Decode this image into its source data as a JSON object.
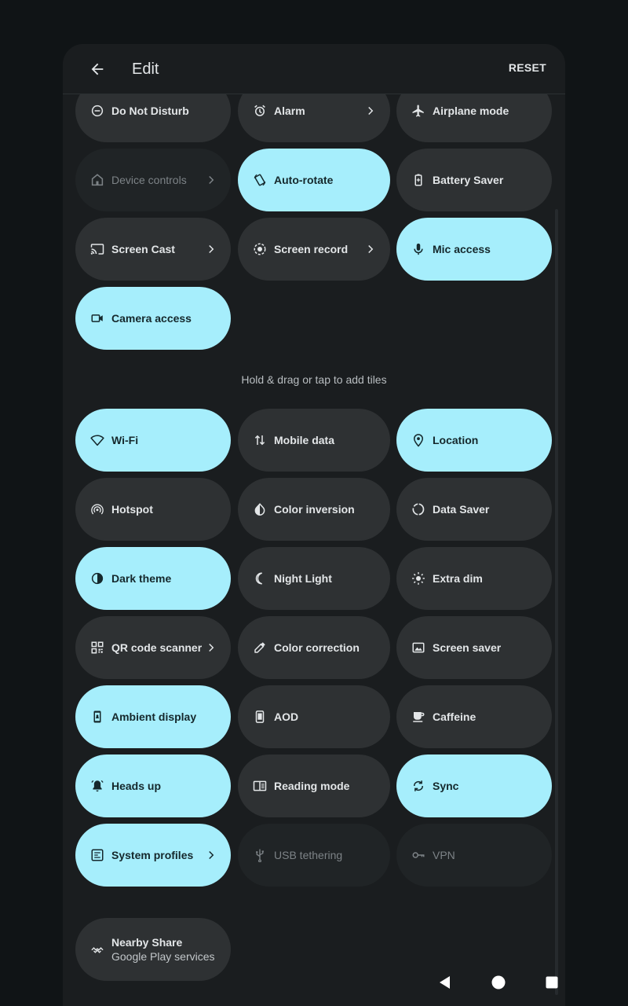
{
  "header": {
    "title": "Edit",
    "reset_label": "RESET"
  },
  "hint": "Hold & drag or tap to add tiles",
  "active_tiles": [
    {
      "label": "Do Not Disturb",
      "icon": "do-not-disturb-icon",
      "state": "off",
      "chevron": false
    },
    {
      "label": "Alarm",
      "icon": "alarm-icon",
      "state": "off",
      "chevron": true
    },
    {
      "label": "Airplane mode",
      "icon": "airplane-icon",
      "state": "off",
      "chevron": false
    },
    {
      "label": "Device controls",
      "icon": "home-icon",
      "state": "unavailable",
      "chevron": true
    },
    {
      "label": "Auto-rotate",
      "icon": "rotate-icon",
      "state": "on",
      "chevron": false
    },
    {
      "label": "Battery Saver",
      "icon": "battery-icon",
      "state": "off",
      "chevron": false
    },
    {
      "label": "Screen Cast",
      "icon": "cast-icon",
      "state": "off",
      "chevron": true
    },
    {
      "label": "Screen record",
      "icon": "record-icon",
      "state": "off",
      "chevron": true
    },
    {
      "label": "Mic access",
      "icon": "mic-icon",
      "state": "on",
      "chevron": false
    },
    {
      "label": "Camera access",
      "icon": "camera-icon",
      "state": "on",
      "chevron": false
    }
  ],
  "available_tiles": [
    {
      "label": "Wi-Fi",
      "icon": "wifi-icon",
      "state": "on",
      "chevron": false
    },
    {
      "label": "Mobile data",
      "icon": "mobile-data-icon",
      "state": "off",
      "chevron": false
    },
    {
      "label": "Location",
      "icon": "location-icon",
      "state": "on",
      "chevron": false
    },
    {
      "label": "Hotspot",
      "icon": "hotspot-icon",
      "state": "off",
      "chevron": false
    },
    {
      "label": "Color inversion",
      "icon": "color-inversion-icon",
      "state": "off",
      "chevron": false
    },
    {
      "label": "Data Saver",
      "icon": "data-saver-icon",
      "state": "off",
      "chevron": false
    },
    {
      "label": "Dark theme",
      "icon": "dark-theme-icon",
      "state": "on",
      "chevron": false
    },
    {
      "label": "Night Light",
      "icon": "moon-icon",
      "state": "off",
      "chevron": false
    },
    {
      "label": "Extra dim",
      "icon": "brightness-icon",
      "state": "off",
      "chevron": false
    },
    {
      "label": "QR code scanner",
      "icon": "qr-code-icon",
      "state": "off",
      "chevron": true
    },
    {
      "label": "Color correction",
      "icon": "eyedropper-icon",
      "state": "off",
      "chevron": false
    },
    {
      "label": "Screen saver",
      "icon": "image-icon",
      "state": "off",
      "chevron": false
    },
    {
      "label": "Ambient display",
      "icon": "ambient-display-icon",
      "state": "on",
      "chevron": false
    },
    {
      "label": "AOD",
      "icon": "phone-icon",
      "state": "off",
      "chevron": false
    },
    {
      "label": "Caffeine",
      "icon": "coffee-icon",
      "state": "off",
      "chevron": false
    },
    {
      "label": "Heads up",
      "icon": "bell-icon",
      "state": "on",
      "chevron": false
    },
    {
      "label": "Reading mode",
      "icon": "book-icon",
      "state": "off",
      "chevron": false
    },
    {
      "label": "Sync",
      "icon": "sync-icon",
      "state": "on",
      "chevron": false
    },
    {
      "label": "System profiles",
      "icon": "profiles-icon",
      "state": "on",
      "chevron": true
    },
    {
      "label": "USB tethering",
      "icon": "usb-icon",
      "state": "unavailable",
      "chevron": false
    },
    {
      "label": "VPN",
      "icon": "key-icon",
      "state": "unavailable",
      "chevron": false
    },
    {
      "label": "Nearby Share",
      "sublabel": "Google Play services",
      "icon": "nearby-share-icon",
      "state": "off",
      "chevron": false
    }
  ],
  "nav": {
    "back": "nav-back-icon",
    "home": "nav-home-icon",
    "recents": "nav-recents-icon"
  },
  "colors": {
    "tile_on": "#a6eefc",
    "tile_off": "#2e3133",
    "tile_unavailable": "#202426",
    "panel": "#1a1d1f",
    "background": "#101416"
  }
}
